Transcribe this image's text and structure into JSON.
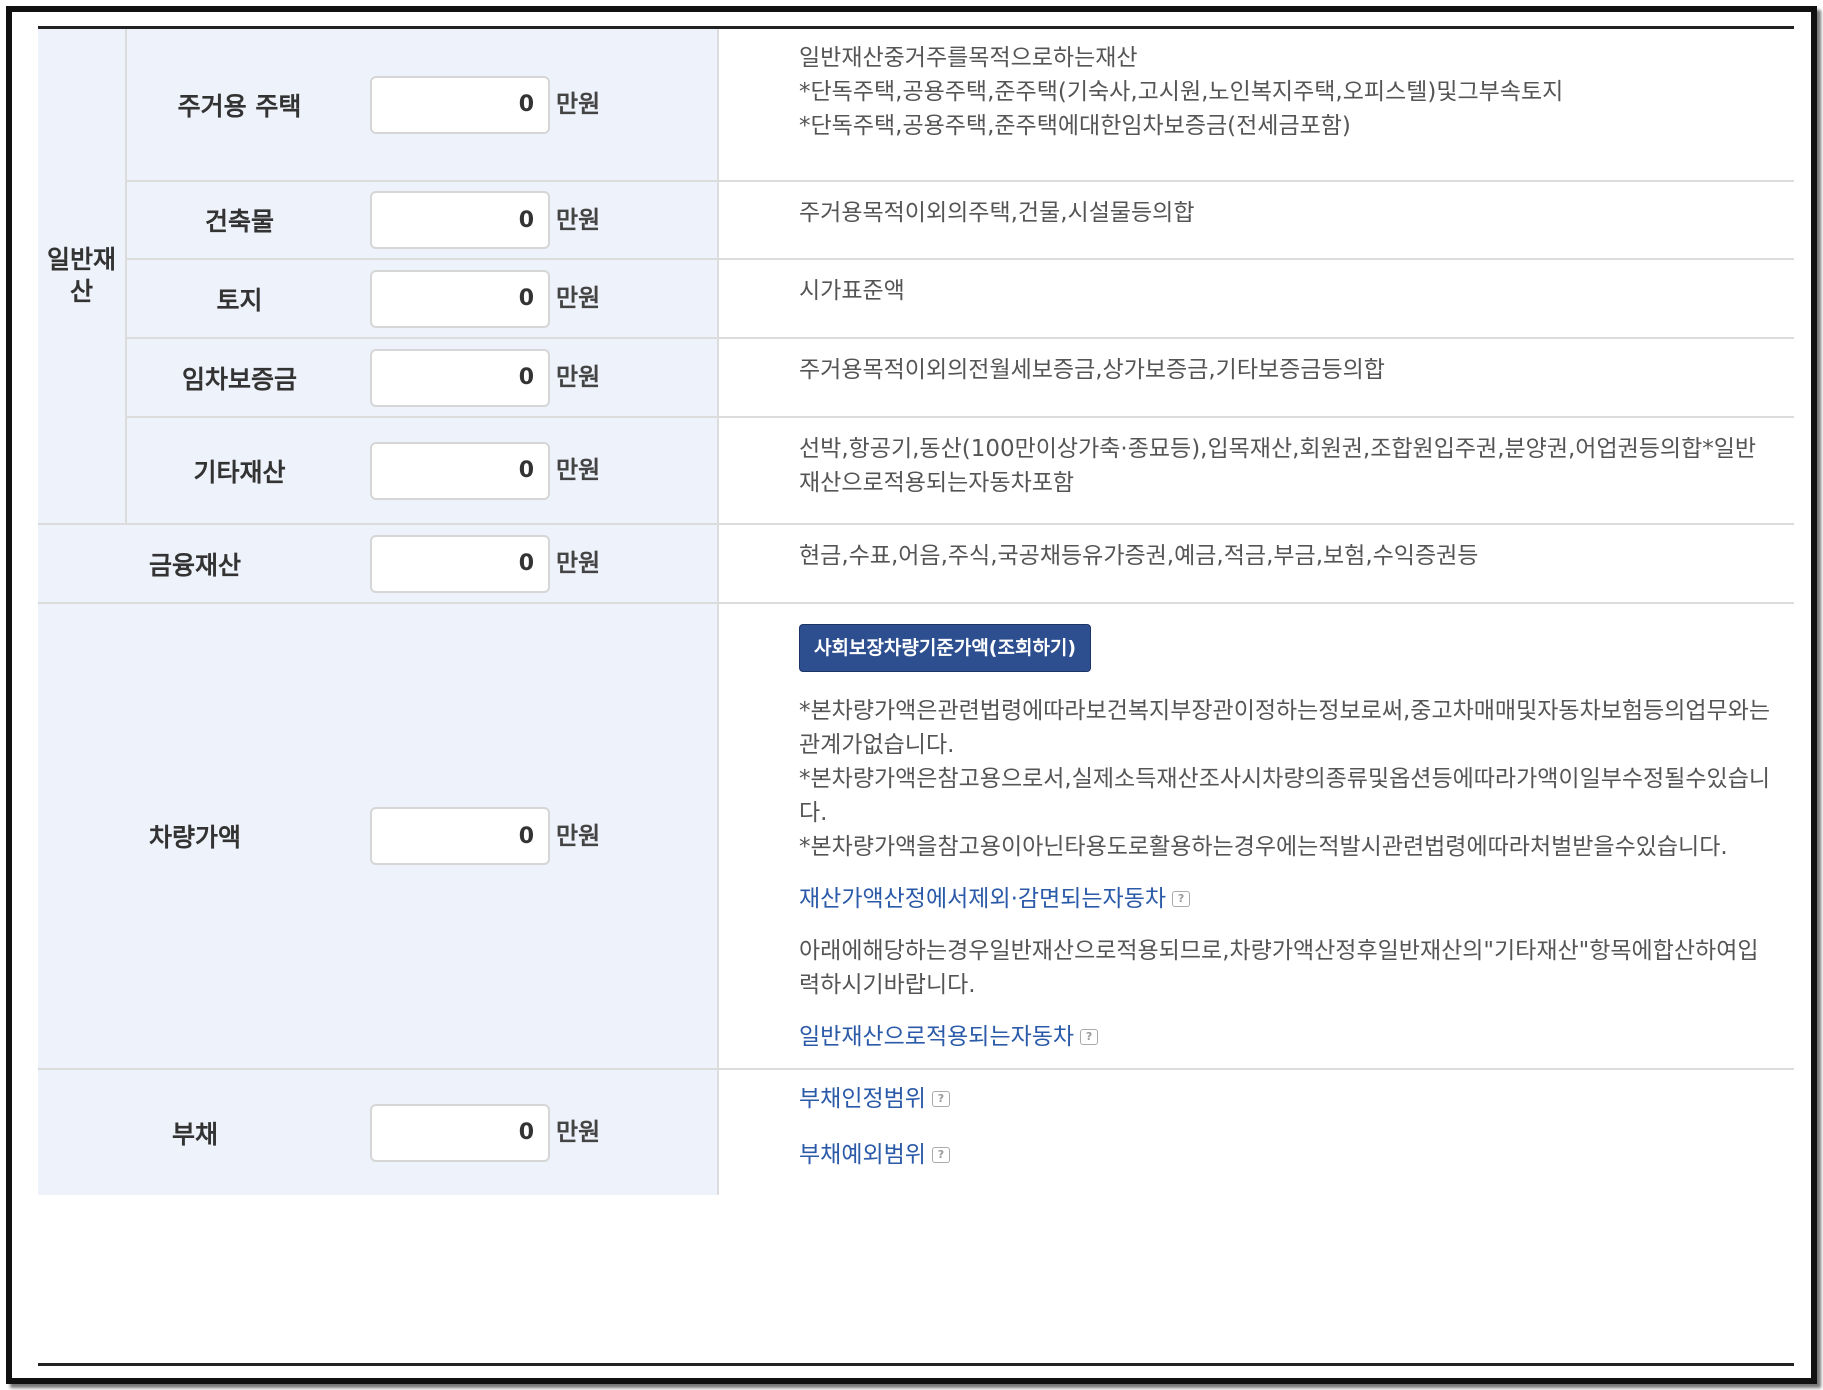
{
  "unit_label": "만원",
  "general_property": {
    "group_label": "일반재산",
    "rows": [
      {
        "label": "주거용 주택",
        "value": "0",
        "description": [
          "일반재산중거주를목적으로하는재산",
          "*단독주택,공용주택,준주택(기숙사,고시원,노인복지주택,오피스텔)및그부속토지",
          "*단독주택,공용주택,준주택에대한임차보증금(전세금포함)"
        ]
      },
      {
        "label": "건축물",
        "value": "0",
        "description": [
          "주거용목적이외의주택,건물,시설물등의합"
        ]
      },
      {
        "label": "토지",
        "value": "0",
        "description": [
          "시가표준액"
        ]
      },
      {
        "label": "임차보증금",
        "value": "0",
        "description": [
          "주거용목적이외의전월세보증금,상가보증금,기타보증금등의합"
        ]
      },
      {
        "label": "기타재산",
        "value": "0",
        "description": [
          "선박,항공기,동산(100만이상가축·종묘등),입목재산,회원권,조합원입주권,분양권,어업권등의합*일반재산으로적용되는자동차포함"
        ]
      }
    ]
  },
  "financial": {
    "label": "금융재산",
    "value": "0",
    "description": "현금,수표,어음,주식,국공채등유가증권,예금,적금,부금,보험,수익증권등"
  },
  "vehicle": {
    "label": "차량가액",
    "value": "0",
    "button_label": "사회보장차량기준가액(조회하기)",
    "notes": [
      "*본차량가액은관련법령에따라보건복지부장관이정하는정보로써,중고차매매및자동차보험등의업무와는관계가없습니다.",
      "*본차량가액은참고용으로서,실제소득재산조사시차량의종류및옵션등에따라가액이일부수정될수있습니다.",
      "*본차량가액을참고용이아닌타용도로활용하는경우에는적발시관련법령에따라처벌받을수있습니다."
    ],
    "link_excluded": "재산가액산정에서제외·감면되는자동차",
    "notice": "아래에해당하는경우일반재산으로적용되므로,차량가액산정후일반재산의\"기타재산\"항목에합산하여입력하시기바랍니다.",
    "link_general": "일반재산으로적용되는자동차"
  },
  "debt": {
    "label": "부채",
    "value": "0",
    "link_scope": "부채인정범위",
    "link_exclusion": "부채예외범위"
  },
  "help_icon": "help-icon"
}
